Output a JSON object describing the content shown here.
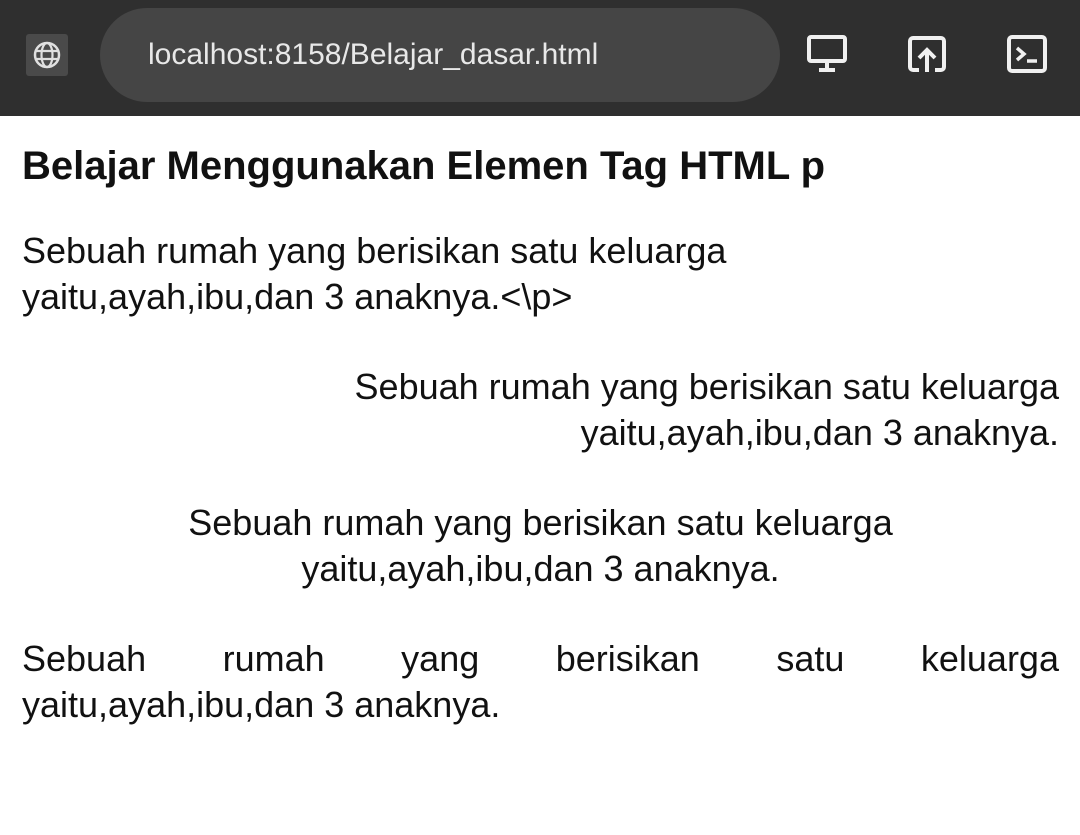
{
  "browser": {
    "url": "localhost:8158/Belajar_dasar.html",
    "icons": [
      "globe-icon",
      "desktop-icon",
      "share-icon",
      "terminal-icon"
    ]
  },
  "page": {
    "heading": "Belajar Menggunakan Elemen Tag HTML p",
    "para1": {
      "line1": "Sebuah rumah yang berisikan satu keluarga",
      "line2": "yaitu,ayah,ibu,dan 3 anaknya.<\\p>"
    },
    "para2": {
      "line1": "Sebuah rumah yang berisikan satu keluarga",
      "line2": "yaitu,ayah,ibu,dan 3 anaknya."
    },
    "para3": {
      "line1": "Sebuah rumah yang berisikan satu keluarga",
      "line2": "yaitu,ayah,ibu,dan 3 anaknya."
    },
    "para4": {
      "words1": [
        "Sebuah",
        "rumah",
        "yang",
        "berisikan",
        "satu",
        "keluarga"
      ],
      "line2": "yaitu,ayah,ibu,dan 3 anaknya."
    }
  }
}
